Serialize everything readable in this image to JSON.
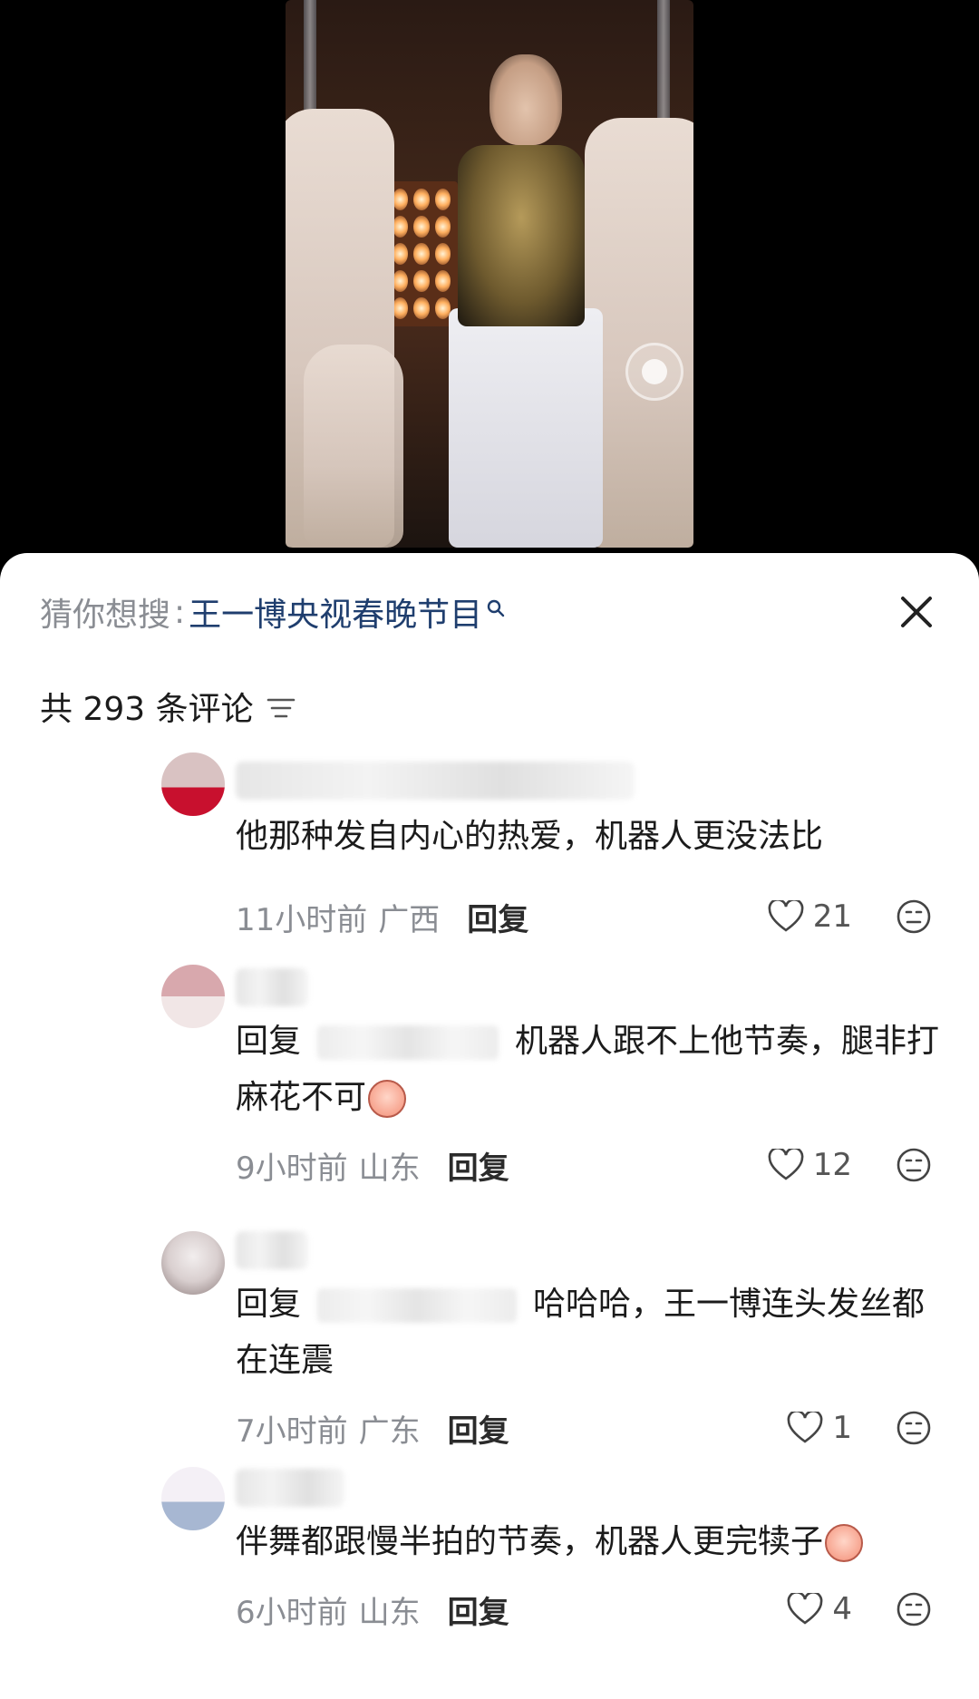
{
  "search": {
    "prefix": "猜你想搜",
    "separator": ":",
    "term": "王一博央视春晚节目"
  },
  "comment_count_label": "共 293 条评论",
  "colors": {
    "search_term": "#1f3e6e",
    "meta_gray": "#8a8d93",
    "text": "#1b1b1b"
  },
  "comments": [
    {
      "text": "他那种发自内心的热爱，机器人更没法比",
      "time": "11小时前",
      "region": "广西",
      "reply_label": "回复",
      "likes": "21"
    },
    {
      "reply_prefix": "回复",
      "text": "机器人跟不上他节奏，腿非打麻花不可",
      "time": "9小时前",
      "region": "山东",
      "reply_label": "回复",
      "likes": "12"
    },
    {
      "reply_prefix": "回复",
      "text": "哈哈哈，王一博连头发丝都在连震",
      "time": "7小时前",
      "region": "广东",
      "reply_label": "回复",
      "likes": "1"
    },
    {
      "text": "伴舞都跟慢半拍的节奏，机器人更完犊子",
      "time": "6小时前",
      "region": "山东",
      "reply_label": "回复",
      "likes": "4"
    }
  ]
}
